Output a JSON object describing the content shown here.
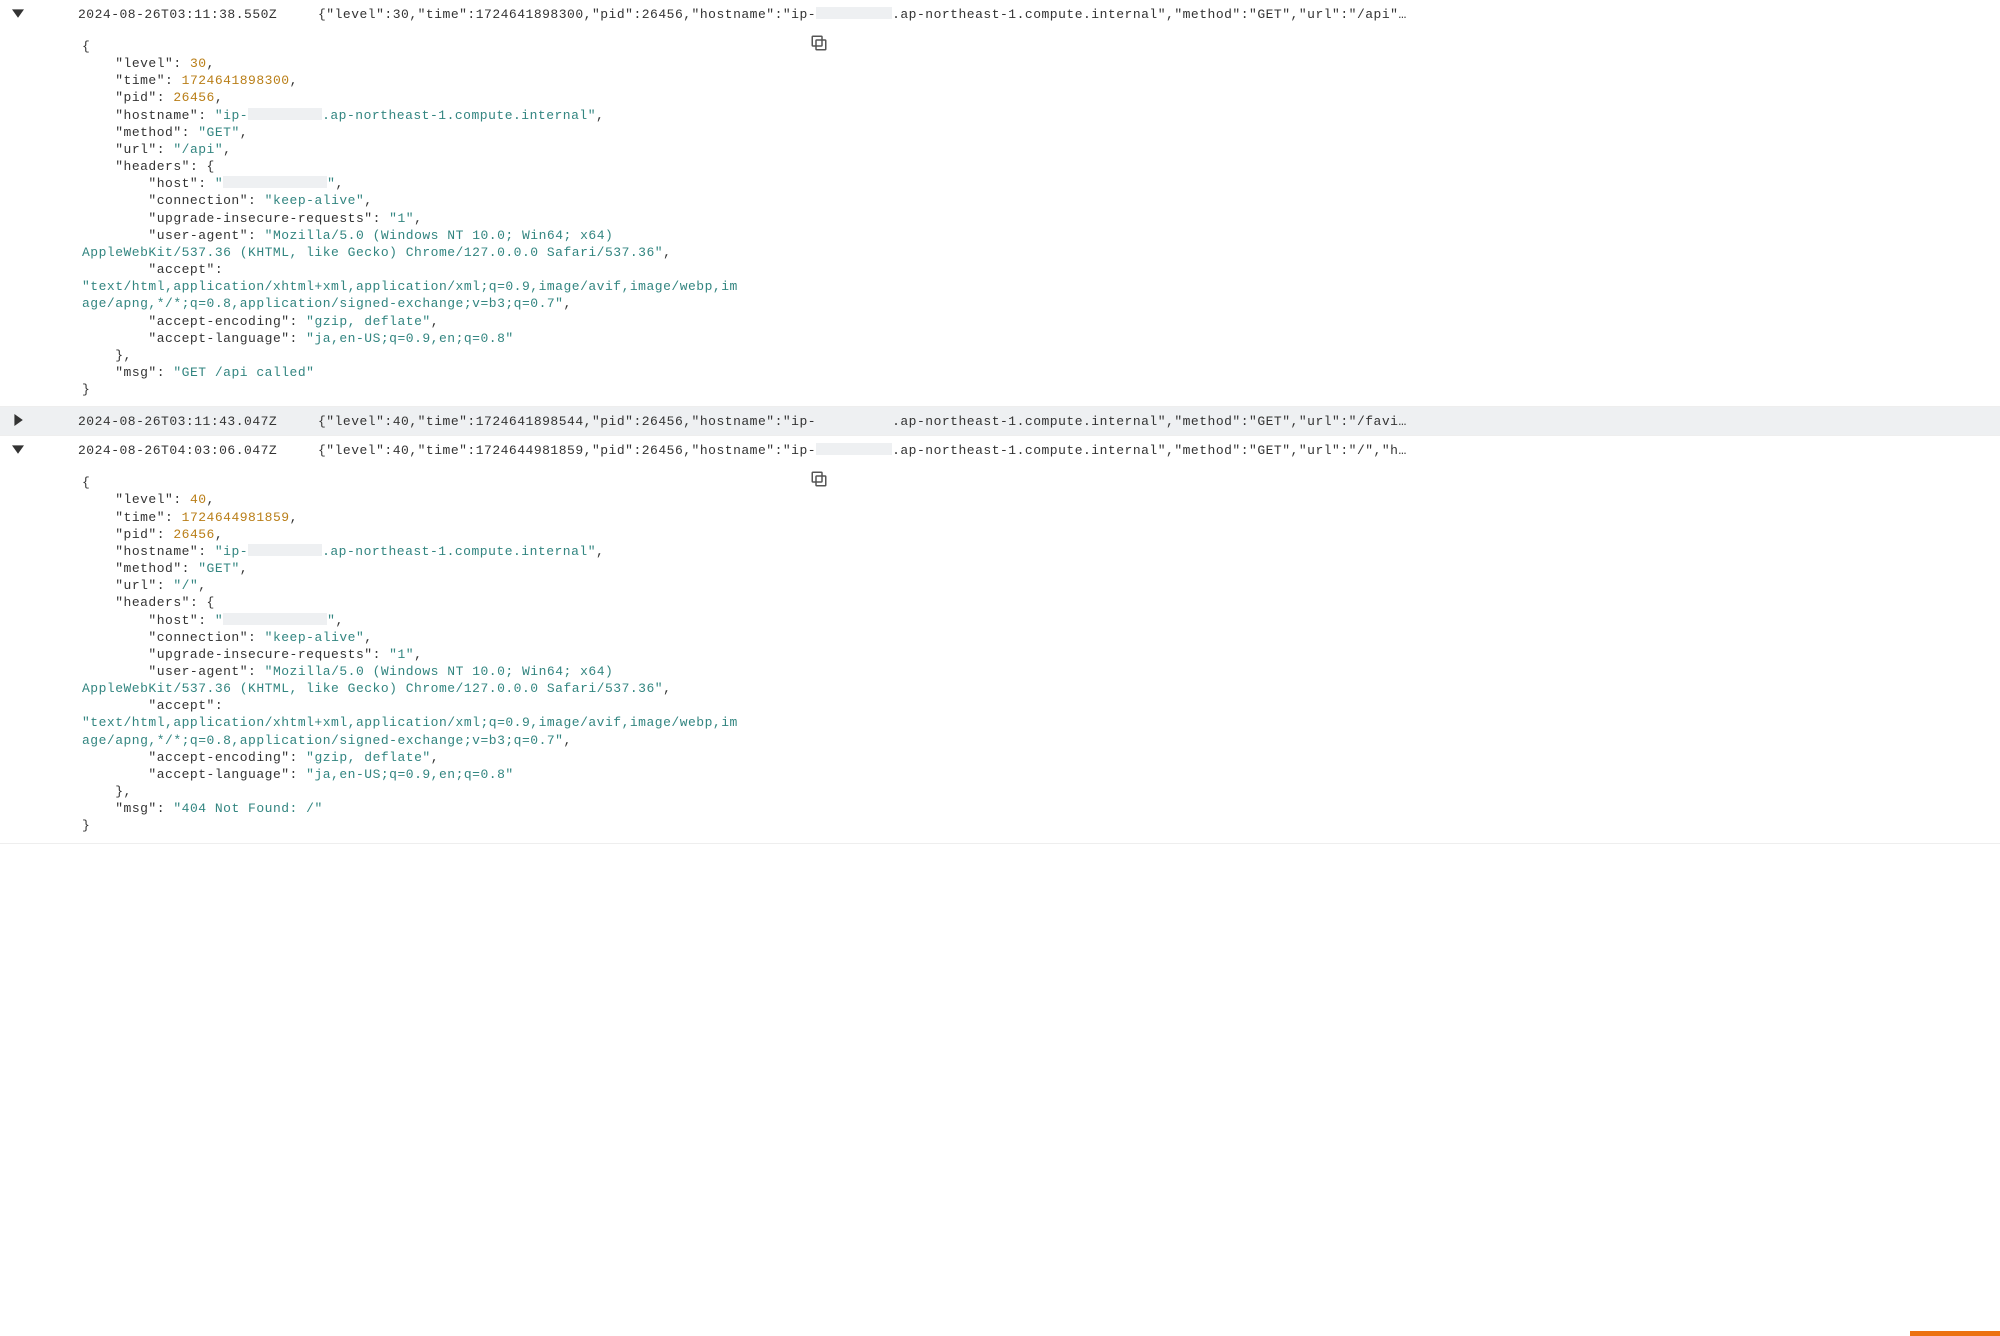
{
  "entries": [
    {
      "expanded": true,
      "shaded_header": false,
      "timestamp": "2024-08-26T03:11:38.550Z",
      "summary_prefix": "{\"level\":30,\"time\":1724641898300,\"pid\":26456,\"hostname\":\"ip-",
      "summary_suffix": ".ap-northeast-1.compute.internal\",\"method\":\"GET\",\"url\":\"/api\"…",
      "redaction_width": 76,
      "body": {
        "level": 30,
        "time": 1724641898300,
        "pid": 26456,
        "hostname_prefix": "ip-",
        "hostname_suffix": ".ap-northeast-1.compute.internal",
        "hostname_redaction_width": 74,
        "method": "GET",
        "url": "/api",
        "headers": {
          "host": "",
          "host_redaction_width": 104,
          "connection": "keep-alive",
          "upgrade-insecure-requests": "1",
          "user-agent": "Mozilla/5.0 (Windows NT 10.0; Win64; x64) AppleWebKit/537.36 (KHTML, like Gecko) Chrome/127.0.0.0 Safari/537.36",
          "accept": "text/html,application/xhtml+xml,application/xml;q=0.9,image/avif,image/webp,image/apng,*/*;q=0.8,application/signed-exchange;v=b3;q=0.7",
          "accept-encoding": "gzip, deflate",
          "accept-language": "ja,en-US;q=0.9,en;q=0.8"
        },
        "msg": "GET /api called"
      }
    },
    {
      "expanded": false,
      "shaded_header": true,
      "timestamp": "2024-08-26T03:11:43.047Z",
      "summary_prefix": "{\"level\":40,\"time\":1724641898544,\"pid\":26456,\"hostname\":\"ip-",
      "summary_suffix": ".ap-northeast-1.compute.internal\",\"method\":\"GET\",\"url\":\"/favi…",
      "redaction_width": 76
    },
    {
      "expanded": true,
      "shaded_header": false,
      "timestamp": "2024-08-26T04:03:06.047Z",
      "summary_prefix": "{\"level\":40,\"time\":1724644981859,\"pid\":26456,\"hostname\":\"ip-",
      "summary_suffix": ".ap-northeast-1.compute.internal\",\"method\":\"GET\",\"url\":\"/\",\"h…",
      "redaction_width": 76,
      "body": {
        "level": 40,
        "time": 1724644981859,
        "pid": 26456,
        "hostname_prefix": "ip-",
        "hostname_suffix": ".ap-northeast-1.compute.internal",
        "hostname_redaction_width": 74,
        "method": "GET",
        "url": "/",
        "headers": {
          "host": "",
          "host_redaction_width": 104,
          "connection": "keep-alive",
          "upgrade-insecure-requests": "1",
          "user-agent": "Mozilla/5.0 (Windows NT 10.0; Win64; x64) AppleWebKit/537.36 (KHTML, like Gecko) Chrome/127.0.0.0 Safari/537.36",
          "accept": "text/html,application/xhtml+xml,application/xml;q=0.9,image/avif,image/webp,image/apng,*/*;q=0.8,application/signed-exchange;v=b3;q=0.7",
          "accept-encoding": "gzip, deflate",
          "accept-language": "ja,en-US;q=0.9,en;q=0.8"
        },
        "msg": "404 Not Found: /"
      }
    }
  ]
}
